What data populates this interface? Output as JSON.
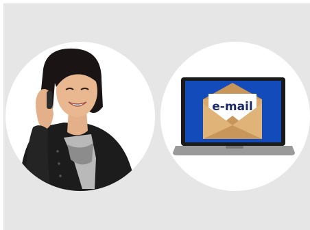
{
  "illustrations": [
    {
      "name": "phone-call",
      "icon": "person-on-phone"
    },
    {
      "name": "email",
      "icon": "laptop-email-envelope",
      "label": "e-mail"
    }
  ],
  "colors": {
    "panel_bg": "#e6e6e6",
    "circle_bg": "#ffffff",
    "envelope": "#d9a86c",
    "screen": "#0b3fa8"
  }
}
